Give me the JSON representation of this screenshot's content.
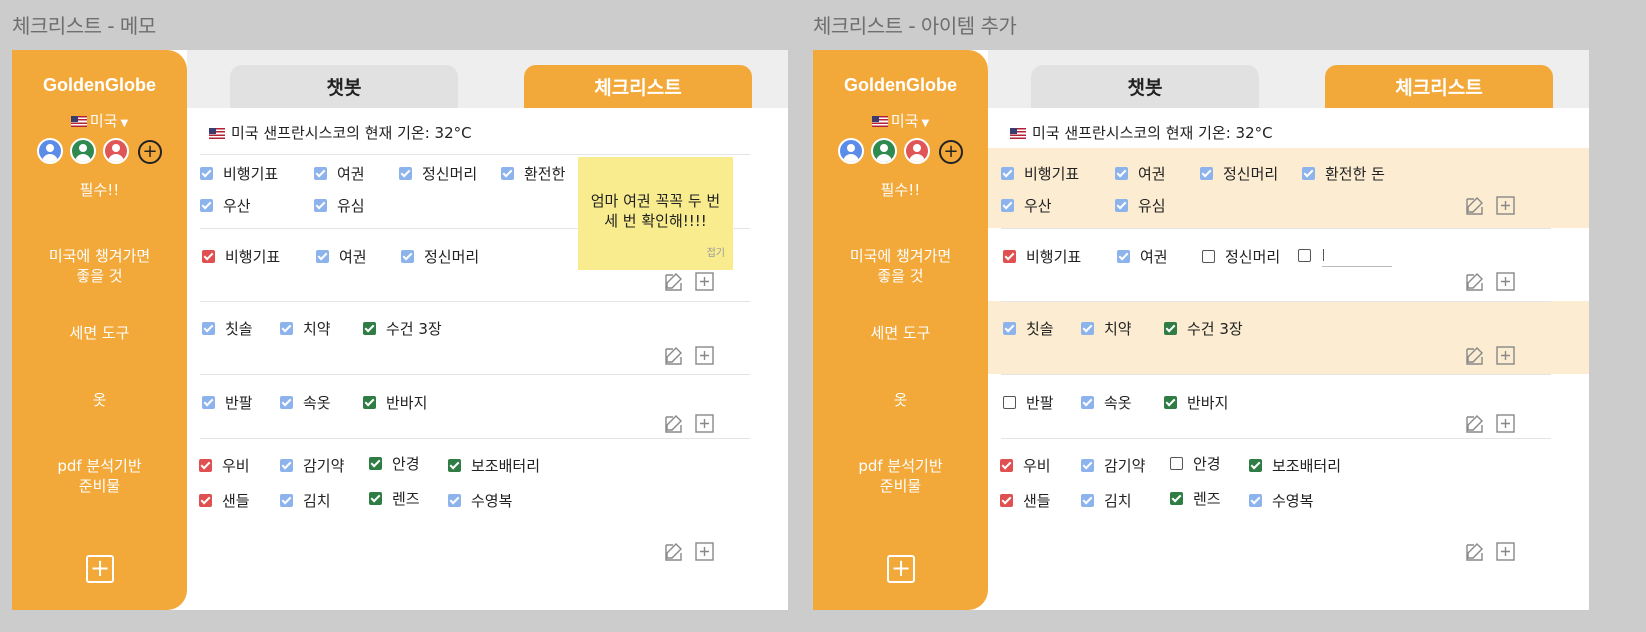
{
  "frames": [
    {
      "title": "체크리스트 - 메모",
      "brand": "GoldenGlobe",
      "country": "미국",
      "sidebar": [
        "필수!!",
        "미국에 챙겨가면\n좋을 것",
        "세면 도구",
        "옷",
        "pdf 분석기반\n준비물"
      ],
      "tabs": {
        "chatbot": "챗봇",
        "checklist": "체크리스트"
      },
      "weather": "미국 샌프란시스코의 현재 기온: 32°C",
      "memo": {
        "text": "엄마 여권 꼭꼭 두 번 세 번 확인해!!!!",
        "close": "접기"
      },
      "sections": [
        {
          "items": [
            {
              "label": "비행기표",
              "state": "blue"
            },
            {
              "label": "여권",
              "state": "blue"
            },
            {
              "label": "정신머리",
              "state": "blue"
            },
            {
              "label": "환전한",
              "state": "blue"
            },
            {
              "label": "우산",
              "state": "blue"
            },
            {
              "label": "유심",
              "state": "blue"
            }
          ]
        },
        {
          "items": [
            {
              "label": "비행기표",
              "state": "red"
            },
            {
              "label": "여권",
              "state": "blue"
            },
            {
              "label": "정신머리",
              "state": "blue"
            }
          ]
        },
        {
          "items": [
            {
              "label": "칫솔",
              "state": "blue"
            },
            {
              "label": "치약",
              "state": "blue"
            },
            {
              "label": "수건 3장",
              "state": "green"
            }
          ]
        },
        {
          "items": [
            {
              "label": "반팔",
              "state": "blue"
            },
            {
              "label": "속옷",
              "state": "blue"
            },
            {
              "label": "반바지",
              "state": "green"
            }
          ]
        },
        {
          "items": [
            {
              "label": "우비",
              "state": "red"
            },
            {
              "label": "감기약",
              "state": "blue"
            },
            {
              "label": "안경",
              "state": "green"
            },
            {
              "label": "보조배터리",
              "state": "green"
            },
            {
              "label": "샌들",
              "state": "red"
            },
            {
              "label": "김치",
              "state": "blue"
            },
            {
              "label": "렌즈",
              "state": "green"
            },
            {
              "label": "수영복",
              "state": "blue"
            }
          ]
        }
      ]
    },
    {
      "title": "체크리스트 - 아이템 추가",
      "brand": "GoldenGlobe",
      "country": "미국",
      "sidebar": [
        "필수!!",
        "미국에 챙겨가면\n좋을 것",
        "세면 도구",
        "옷",
        "pdf 분석기반\n준비물"
      ],
      "tabs": {
        "chatbot": "챗봇",
        "checklist": "체크리스트"
      },
      "weather": "미국 샌프란시스코의 현재 기온: 32°C",
      "sections": [
        {
          "items": [
            {
              "label": "비행기표",
              "state": "blue"
            },
            {
              "label": "여권",
              "state": "blue"
            },
            {
              "label": "정신머리",
              "state": "blue"
            },
            {
              "label": "환전한 돈",
              "state": "blue"
            },
            {
              "label": "우산",
              "state": "blue"
            },
            {
              "label": "유심",
              "state": "blue"
            }
          ]
        },
        {
          "items": [
            {
              "label": "비행기표",
              "state": "red"
            },
            {
              "label": "여권",
              "state": "blue"
            },
            {
              "label": "정신머리",
              "state": "empty"
            },
            {
              "label": "",
              "state": "empty"
            }
          ]
        },
        {
          "items": [
            {
              "label": "칫솔",
              "state": "blue"
            },
            {
              "label": "치약",
              "state": "blue"
            },
            {
              "label": "수건 3장",
              "state": "green"
            }
          ]
        },
        {
          "items": [
            {
              "label": "반팔",
              "state": "empty"
            },
            {
              "label": "속옷",
              "state": "blue"
            },
            {
              "label": "반바지",
              "state": "green"
            }
          ]
        },
        {
          "items": [
            {
              "label": "우비",
              "state": "red"
            },
            {
              "label": "감기약",
              "state": "blue"
            },
            {
              "label": "안경",
              "state": "empty"
            },
            {
              "label": "보조배터리",
              "state": "green"
            },
            {
              "label": "샌들",
              "state": "red"
            },
            {
              "label": "김치",
              "state": "blue"
            },
            {
              "label": "렌즈",
              "state": "green"
            },
            {
              "label": "수영복",
              "state": "blue"
            }
          ]
        }
      ]
    }
  ],
  "colors": {
    "accent": "#f2a93a",
    "highlight": "#fcecd2",
    "memo": "#f9ec8e",
    "check_blue": "#8db3ec",
    "check_red": "#e05050",
    "check_green": "#2f7d45"
  },
  "icons": {
    "edit": "edit-icon",
    "add": "add-icon",
    "avatar": "user-avatar-icon",
    "flag": "us-flag-icon"
  }
}
